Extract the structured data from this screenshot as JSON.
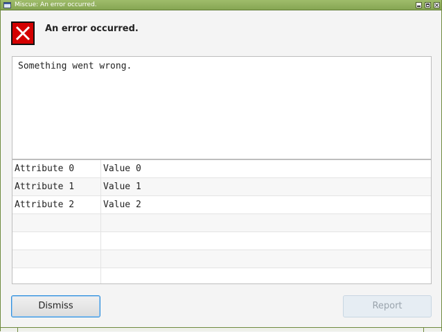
{
  "window": {
    "title": "Miscue: An error occurred.",
    "controls": [
      "minimize-icon",
      "maximize-icon",
      "close-icon"
    ]
  },
  "header": {
    "icon": "error-icon",
    "title": "An error occurred."
  },
  "message": {
    "text": "Something went wrong."
  },
  "attributes": {
    "rows": [
      {
        "attribute": "Attribute 0",
        "value": "Value 0"
      },
      {
        "attribute": "Attribute 1",
        "value": "Value 1"
      },
      {
        "attribute": "Attribute 2",
        "value": "Value 2"
      },
      {
        "attribute": "",
        "value": ""
      },
      {
        "attribute": "",
        "value": ""
      },
      {
        "attribute": "",
        "value": ""
      },
      {
        "attribute": "",
        "value": ""
      }
    ]
  },
  "buttons": {
    "dismiss_label": "Dismiss",
    "report_label": "Report",
    "report_enabled": false
  },
  "colors": {
    "titlebar": "#93b25f",
    "error_icon": "#d40000",
    "focus_border": "#2f8fdc"
  }
}
